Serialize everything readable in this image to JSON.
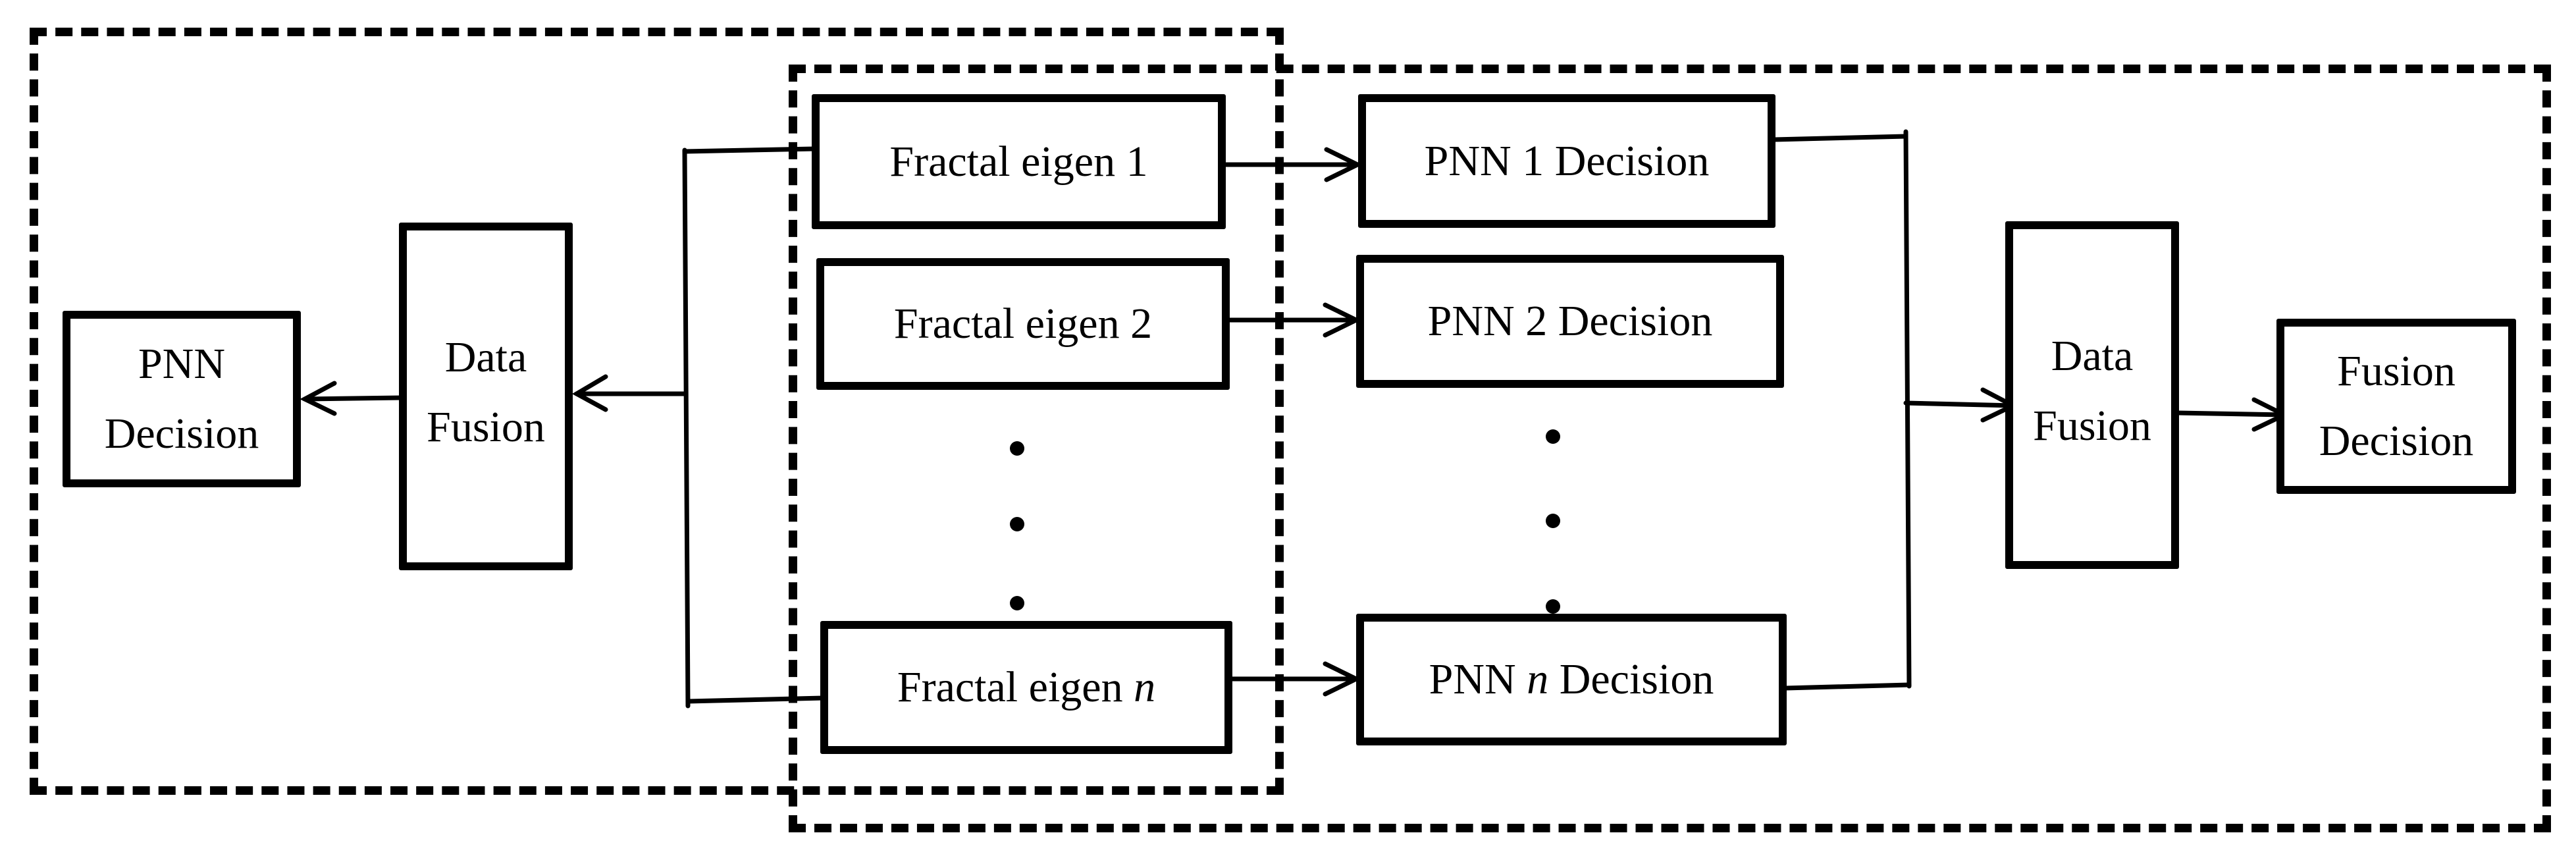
{
  "diagram": {
    "type": "flowchart",
    "description": "Fractal eigen features feed parallel PNN decisions fused by data fusion, versus feature-level data fusion feeding a single PNN",
    "left_group": {
      "pnn_decision": {
        "line1": "PNN",
        "line2": "Decision"
      },
      "data_fusion": {
        "line1": "Data",
        "line2": "Fusion"
      }
    },
    "features": [
      {
        "prefix": "Fractal eigen",
        "index": "1",
        "italic_index": false
      },
      {
        "prefix": "Fractal eigen",
        "index": "2",
        "italic_index": false
      },
      {
        "prefix": "Fractal eigen",
        "index": "n",
        "italic_index": true
      }
    ],
    "pnn_decisions": [
      {
        "prefix": "PNN",
        "index": "1",
        "suffix": "Decision",
        "italic_index": false
      },
      {
        "prefix": "PNN",
        "index": "2",
        "suffix": "Decision",
        "italic_index": false
      },
      {
        "prefix": "PNN",
        "index": "n",
        "suffix": "Decision",
        "italic_index": true
      }
    ],
    "right_group": {
      "data_fusion": {
        "line1": "Data",
        "line2": "Fusion"
      },
      "fusion_decision": {
        "line1": "Fusion",
        "line2": "Decision"
      }
    },
    "ellipsis_dots": 3,
    "edges": [
      {
        "from": "features-bus",
        "to": "left-data-fusion"
      },
      {
        "from": "left-data-fusion",
        "to": "pnn-decision"
      },
      {
        "from": "fractal-eigen-1",
        "to": "pnn-1-decision"
      },
      {
        "from": "fractal-eigen-2",
        "to": "pnn-2-decision"
      },
      {
        "from": "fractal-eigen-n",
        "to": "pnn-n-decision"
      },
      {
        "from": "pnn-bus",
        "to": "right-data-fusion"
      },
      {
        "from": "right-data-fusion",
        "to": "fusion-decision"
      }
    ]
  }
}
